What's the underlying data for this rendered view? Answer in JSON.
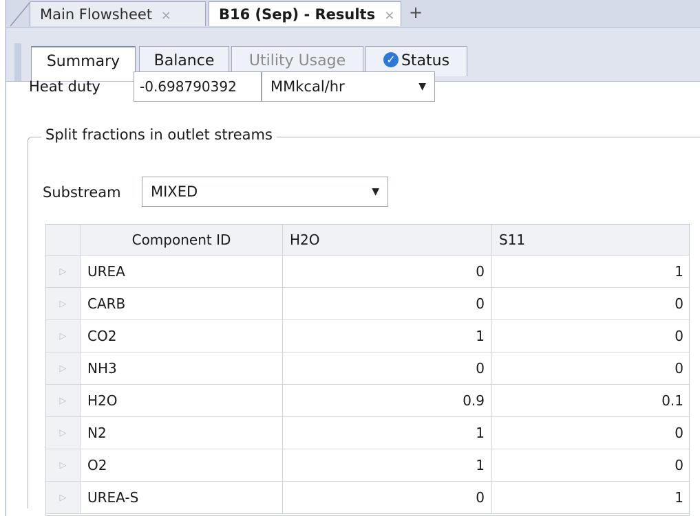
{
  "doc_tabs": [
    {
      "label": "Main Flowsheet",
      "close": "×"
    },
    {
      "label": "B16 (Sep) - Results",
      "close": "×"
    }
  ],
  "add_tab": "+",
  "form_tabs": [
    "Summary",
    "Balance",
    "Utility Usage",
    "Status"
  ],
  "status_icon": "check-circle-icon",
  "heat_duty": {
    "label": "Heat duty",
    "value": "-0.698790392",
    "unit": "MMkcal/hr"
  },
  "split_fractions": {
    "title": "Split fractions in outlet streams",
    "substream_label": "Substream",
    "substream_value": "MIXED"
  },
  "table": {
    "columns": [
      "Component ID",
      "H2O",
      "S11"
    ],
    "rows": [
      {
        "id": "UREA",
        "h2o": "0",
        "s11": "1"
      },
      {
        "id": "CARB",
        "h2o": "0",
        "s11": "0"
      },
      {
        "id": "CO2",
        "h2o": "1",
        "s11": "0"
      },
      {
        "id": "NH3",
        "h2o": "0",
        "s11": "0"
      },
      {
        "id": "H2O",
        "h2o": "0.9",
        "s11": "0.1"
      },
      {
        "id": "N2",
        "h2o": "1",
        "s11": "0"
      },
      {
        "id": "O2",
        "h2o": "1",
        "s11": "0"
      },
      {
        "id": "UREA-S",
        "h2o": "0",
        "s11": "1"
      }
    ]
  },
  "colors": {
    "tab_strip": "#d6dbe9",
    "form_tabbar": "#dfe4ef",
    "status_blue": "#2f79d6",
    "grid_header": "#f1f2f5"
  }
}
